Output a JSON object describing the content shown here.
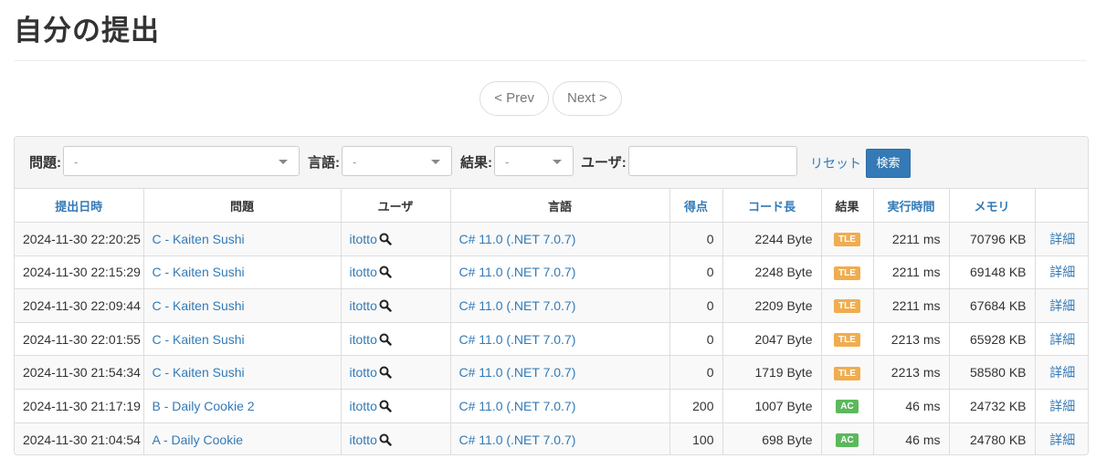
{
  "page": {
    "title": "自分の提出"
  },
  "pager": {
    "prev": "< Prev",
    "next": "Next >"
  },
  "filter": {
    "problem_label": "問題:",
    "problem_value": "-",
    "language_label": "言語:",
    "language_value": "-",
    "result_label": "結果:",
    "result_value": "-",
    "user_label": "ユーザ:",
    "user_value": "",
    "reset": "リセット",
    "search": "検索"
  },
  "table": {
    "headers": {
      "date": "提出日時",
      "problem": "問題",
      "user": "ユーザ",
      "language": "言語",
      "score": "得点",
      "code_length": "コード長",
      "result": "結果",
      "time": "実行時間",
      "memory": "メモリ"
    },
    "rows": [
      {
        "date": "2024-11-30 22:20:25",
        "problem": "C - Kaiten Sushi",
        "user": "itotto",
        "language": "C# 11.0 (.NET 7.0.7)",
        "score": "0",
        "code_length": "2244 Byte",
        "result": "TLE",
        "time": "2211 ms",
        "memory": "70796 KB",
        "detail": "詳細"
      },
      {
        "date": "2024-11-30 22:15:29",
        "problem": "C - Kaiten Sushi",
        "user": "itotto",
        "language": "C# 11.0 (.NET 7.0.7)",
        "score": "0",
        "code_length": "2248 Byte",
        "result": "TLE",
        "time": "2211 ms",
        "memory": "69148 KB",
        "detail": "詳細"
      },
      {
        "date": "2024-11-30 22:09:44",
        "problem": "C - Kaiten Sushi",
        "user": "itotto",
        "language": "C# 11.0 (.NET 7.0.7)",
        "score": "0",
        "code_length": "2209 Byte",
        "result": "TLE",
        "time": "2211 ms",
        "memory": "67684 KB",
        "detail": "詳細"
      },
      {
        "date": "2024-11-30 22:01:55",
        "problem": "C - Kaiten Sushi",
        "user": "itotto",
        "language": "C# 11.0 (.NET 7.0.7)",
        "score": "0",
        "code_length": "2047 Byte",
        "result": "TLE",
        "time": "2213 ms",
        "memory": "65928 KB",
        "detail": "詳細"
      },
      {
        "date": "2024-11-30 21:54:34",
        "problem": "C - Kaiten Sushi",
        "user": "itotto",
        "language": "C# 11.0 (.NET 7.0.7)",
        "score": "0",
        "code_length": "1719 Byte",
        "result": "TLE",
        "time": "2213 ms",
        "memory": "58580 KB",
        "detail": "詳細"
      },
      {
        "date": "2024-11-30 21:17:19",
        "problem": "B - Daily Cookie 2",
        "user": "itotto",
        "language": "C# 11.0 (.NET 7.0.7)",
        "score": "200",
        "code_length": "1007 Byte",
        "result": "AC",
        "time": "46 ms",
        "memory": "24732 KB",
        "detail": "詳細"
      },
      {
        "date": "2024-11-30 21:04:54",
        "problem": "A - Daily Cookie",
        "user": "itotto",
        "language": "C# 11.0 (.NET 7.0.7)",
        "score": "100",
        "code_length": "698 Byte",
        "result": "AC",
        "time": "46 ms",
        "memory": "24780 KB",
        "detail": "詳細"
      }
    ]
  },
  "colors": {
    "link": "#337ab7",
    "tle": "#f0ad4e",
    "ac": "#5cb85c",
    "search_button": "#337ab7"
  },
  "icons": {
    "user_search": "magnifier-icon",
    "dropdown": "caret-down-icon"
  }
}
